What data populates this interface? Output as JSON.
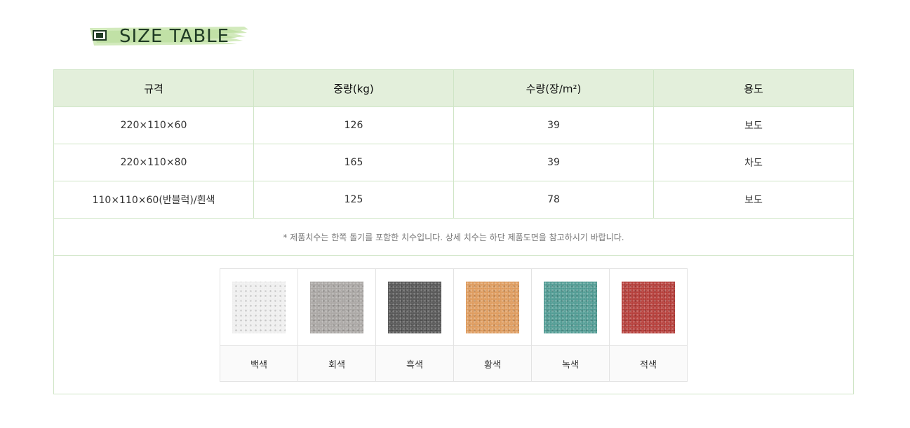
{
  "title": "SIZE TABLE",
  "table": {
    "headers": [
      "규격",
      "중량(kg)",
      "수량(장/m²)",
      "용도"
    ],
    "rows": [
      [
        "220×110×60",
        "126",
        "39",
        "보도"
      ],
      [
        "220×110×80",
        "165",
        "39",
        "차도"
      ],
      [
        "110×110×60(반블럭)/흰색",
        "125",
        "78",
        "보도"
      ]
    ],
    "note": "* 제품치수는 한쪽 돌기를 포함한 치수입니다. 상세 치수는 하단 제품도면을 참고하시기 바랍니다."
  },
  "swatches": [
    {
      "label": "백색",
      "color": "#eeeeee"
    },
    {
      "label": "회색",
      "color": "#a9a6a3"
    },
    {
      "label": "흑색",
      "color": "#555555"
    },
    {
      "label": "황색",
      "color": "#dd9a5c"
    },
    {
      "label": "녹색",
      "color": "#4f9a92"
    },
    {
      "label": "적색",
      "color": "#b43b37"
    }
  ],
  "colors": {
    "accent_green": "#1f3b24",
    "header_bg": "#e3efdb",
    "border": "#cfe5c6"
  }
}
